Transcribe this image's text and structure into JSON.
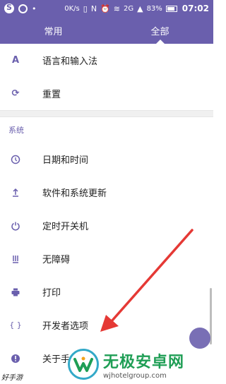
{
  "status": {
    "speed": "0K/s",
    "network": "2G",
    "battery": "83%",
    "time": "07:02"
  },
  "tabs": [
    {
      "label": "常用"
    },
    {
      "label": "全部",
      "active": true
    }
  ],
  "top_items": [
    {
      "label": "语言和输入法",
      "icon": "language-icon"
    },
    {
      "label": "重置",
      "icon": "reset-icon"
    }
  ],
  "system": {
    "title": "系统",
    "items": [
      {
        "label": "日期和时间",
        "icon": "clock-icon"
      },
      {
        "label": "软件和系统更新",
        "icon": "update-icon"
      },
      {
        "label": "定时开关机",
        "icon": "power-icon"
      },
      {
        "label": "无障碍",
        "icon": "accessibility-icon"
      },
      {
        "label": "打印",
        "icon": "printer-icon"
      },
      {
        "label": "开发者选项",
        "icon": "developer-icon"
      },
      {
        "label": "关于手",
        "icon": "info-icon"
      }
    ]
  },
  "watermark": {
    "title": "无极安卓网",
    "url": "wjhotelgroup.com"
  },
  "signature": "好手游"
}
